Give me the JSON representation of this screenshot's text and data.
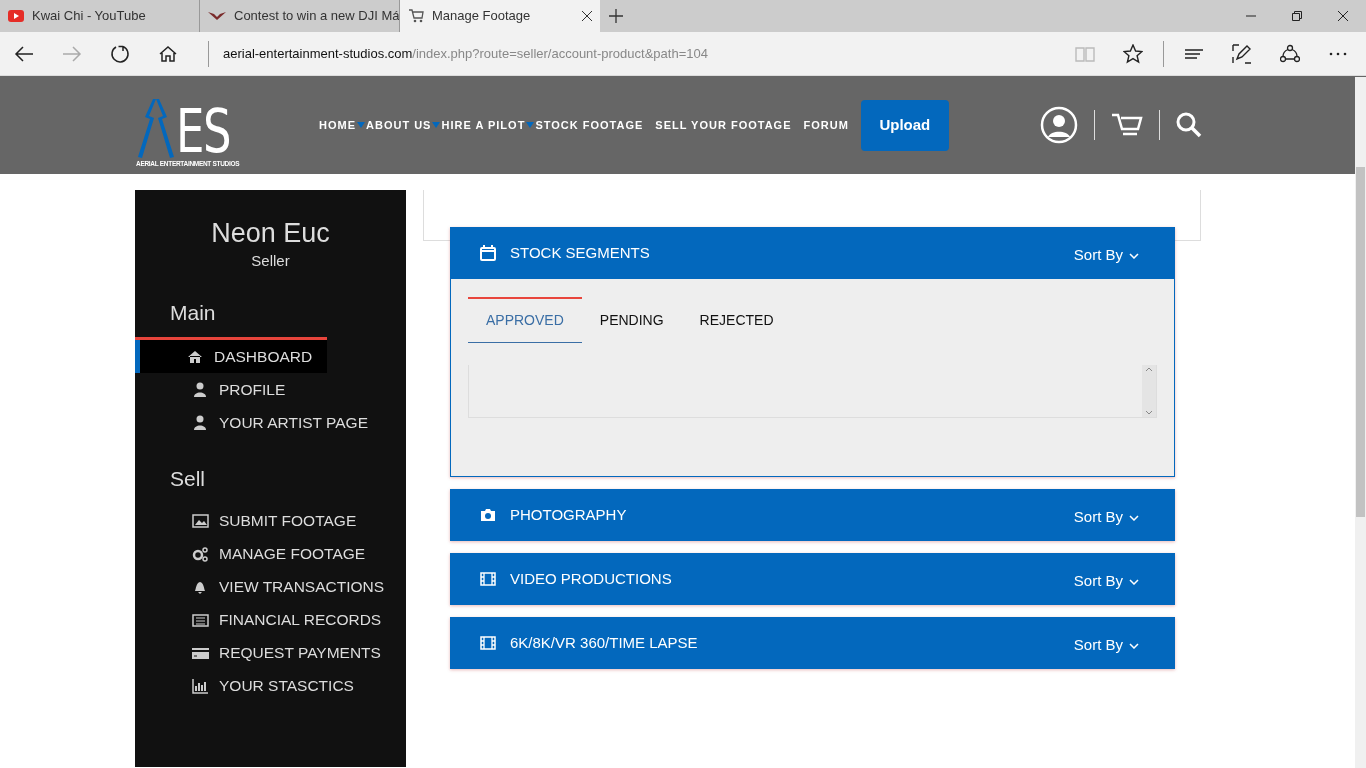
{
  "browser": {
    "tabs": [
      {
        "title": "Kwai Chi - YouTube",
        "selected": false
      },
      {
        "title": "Contest to win a new DJI Má",
        "selected": false
      },
      {
        "title": "Manage Footage",
        "selected": true
      }
    ],
    "address": {
      "domain": "aerial-entertainment-studios.com",
      "path": "/index.php?route=seller/account-product&path=104"
    }
  },
  "site": {
    "logo": {
      "letters": "ES",
      "tagline": "AERIAL ENTERTAINMENT STUDIOS"
    },
    "nav": [
      {
        "label": "HOME",
        "dropdown": true
      },
      {
        "label": "ABOUT US",
        "dropdown": true
      },
      {
        "label": "HIRE A PILOT",
        "dropdown": true
      },
      {
        "label": "STOCK FOOTAGE",
        "dropdown": false
      },
      {
        "label": "SELL YOUR FOOTAGE",
        "dropdown": false
      },
      {
        "label": "FORUM",
        "dropdown": false
      }
    ],
    "upload_button": "Upload"
  },
  "sidebar": {
    "user": {
      "name": "Neon Euc",
      "role": "Seller"
    },
    "sections": [
      {
        "title": "Main",
        "items": [
          {
            "label": "DASHBOARD",
            "selected": true
          },
          {
            "label": "PROFILE",
            "selected": false
          },
          {
            "label": "YOUR ARTIST PAGE",
            "selected": false
          }
        ]
      },
      {
        "title": "Sell",
        "items": [
          {
            "label": "SUBMIT FOOTAGE",
            "selected": false
          },
          {
            "label": "MANAGE FOOTAGE",
            "selected": false
          },
          {
            "label": "VIEW TRANSACTIONS",
            "selected": false
          },
          {
            "label": "FINANCIAL RECORDS",
            "selected": false
          },
          {
            "label": "REQUEST PAYMENTS",
            "selected": false
          },
          {
            "label": "YOUR STASCTICS",
            "selected": false
          }
        ]
      }
    ]
  },
  "panels": [
    {
      "title": "STOCK SEGMENTS",
      "sort_label": "Sort By",
      "expanded": true,
      "tabs": [
        {
          "label": "APPROVED",
          "selected": true
        },
        {
          "label": "PENDING",
          "selected": false
        },
        {
          "label": "REJECTED",
          "selected": false
        }
      ]
    },
    {
      "title": "PHOTOGRAPHY",
      "sort_label": "Sort By",
      "expanded": false
    },
    {
      "title": "VIDEO PRODUCTIONS",
      "sort_label": "Sort By",
      "expanded": false
    },
    {
      "title": "6K/8K/VR 360/TIME LAPSE",
      "sort_label": "Sort By",
      "expanded": false
    }
  ]
}
